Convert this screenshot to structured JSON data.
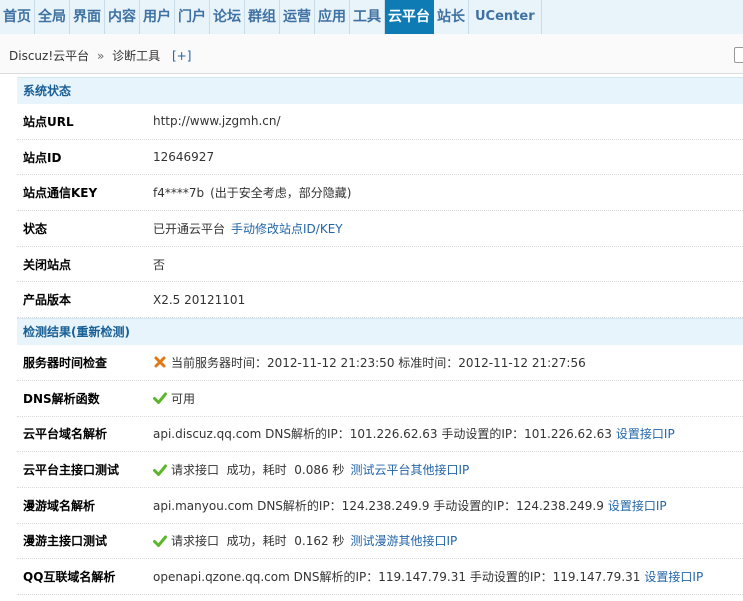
{
  "topnav": {
    "items": [
      "首页",
      "全局",
      "界面",
      "内容",
      "用户",
      "门户",
      "论坛",
      "群组",
      "运营",
      "应用",
      "工具",
      "云平台",
      "站长",
      "UCenter"
    ],
    "active_index": 11
  },
  "breadcrumb": {
    "root": "Discuz!云平台",
    "sep": "»",
    "current": "诊断工具",
    "plus": "[+]"
  },
  "system_status": {
    "title": "系统状态",
    "site_url": {
      "label": "站点URL",
      "value": "http://www.jzgmh.cn/"
    },
    "site_id": {
      "label": "站点ID",
      "value": "12646927"
    },
    "site_key": {
      "label": "站点通信KEY",
      "value": "f4****7b",
      "note": "(出于安全考虑，部分隐藏)"
    },
    "status": {
      "label": "状态",
      "value": "已开通云平台",
      "link": "手动修改站点ID/KEY"
    },
    "closed": {
      "label": "关闭站点",
      "value": "否"
    },
    "version": {
      "label": "产品版本",
      "value": "X2.5 20121101"
    }
  },
  "check_results": {
    "title": "检测结果(重新检测)",
    "server_time": {
      "label": "服务器时间检查",
      "icon": "cross-icon",
      "value": "当前服务器时间：2012-11-12 21:23:50 标准时间：2012-11-12 21:27:56"
    },
    "dns_func": {
      "label": "DNS解析函数",
      "icon": "check-icon",
      "value": "可用"
    },
    "cloud_dns": {
      "label": "云平台域名解析",
      "value": "api.discuz.qq.com DNS解析的IP：101.226.62.63 手动设置的IP：101.226.62.63",
      "link": "设置接口IP"
    },
    "cloud_api": {
      "label": "云平台主接口测试",
      "icon": "check-icon",
      "value": "请求接口  成功，耗时  0.086 秒",
      "link": "测试云平台其他接口IP"
    },
    "manyou_dns": {
      "label": "漫游域名解析",
      "value": "api.manyou.com DNS解析的IP：124.238.249.9 手动设置的IP：124.238.249.9",
      "link": "设置接口IP"
    },
    "manyou_api": {
      "label": "漫游主接口测试",
      "icon": "check-icon",
      "value": "请求接口  成功，耗时  0.162 秒",
      "link": "测试漫游其他接口IP"
    },
    "qq_dns": {
      "label": "QQ互联域名解析",
      "value": "openapi.qzone.qq.com DNS解析的IP：119.147.79.31 手动设置的IP：119.147.79.31",
      "link": "设置接口IP"
    }
  },
  "colors": {
    "accent": "#0f7bb5",
    "link": "#2366a8",
    "section_bg": "#e8f4fb",
    "ok": "#5cb82a",
    "error": "#e07818"
  }
}
